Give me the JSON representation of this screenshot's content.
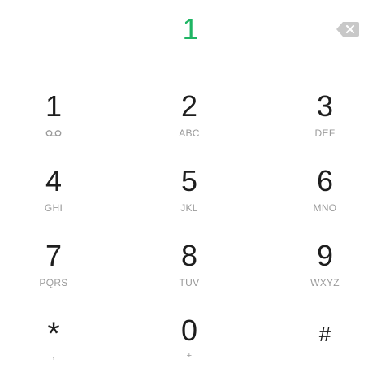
{
  "display": {
    "number": "1",
    "backspace_icon": "backspace-icon"
  },
  "keypad": {
    "keys": [
      {
        "digit": "1",
        "sub": "",
        "sub_icon": "voicemail-icon"
      },
      {
        "digit": "2",
        "sub": "ABC"
      },
      {
        "digit": "3",
        "sub": "DEF"
      },
      {
        "digit": "4",
        "sub": "GHI"
      },
      {
        "digit": "5",
        "sub": "JKL"
      },
      {
        "digit": "6",
        "sub": "MNO"
      },
      {
        "digit": "7",
        "sub": "PQRS"
      },
      {
        "digit": "8",
        "sub": "TUV"
      },
      {
        "digit": "9",
        "sub": "WXYZ"
      },
      {
        "digit": "*",
        "sub": ","
      },
      {
        "digit": "0",
        "sub": "+"
      },
      {
        "digit": "#",
        "sub": ""
      }
    ]
  },
  "colors": {
    "accent": "#1fb564",
    "digit": "#1e1e1e",
    "sub": "#9a9a9a",
    "background": "#ffffff"
  }
}
